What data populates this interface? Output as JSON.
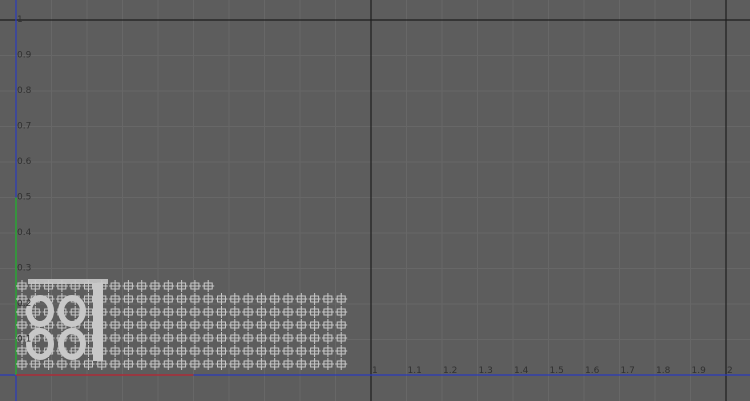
{
  "viewport": {
    "background_color": "#5d5d5d",
    "grid_minor_color": "#676767",
    "grid_major_color": "#1e1e1e",
    "axis_u_color": "#2b3bbd",
    "axis_v_color": "#2b3bbd",
    "axis_origin_x_color": "#b03030",
    "axis_origin_y_color": "#2da82d",
    "uv_shell_color": "#c8c8c8",
    "y_axis_labels": [
      "1",
      "0.9",
      "0.8",
      "0.7",
      "0.6",
      "0.5",
      "0.4",
      "0.3",
      "0.2",
      "0.1"
    ],
    "x_axis_labels": [
      "1",
      "1.1",
      "1.2",
      "1.3",
      "1.4",
      "1.5",
      "1.6",
      "1.7",
      "1.8",
      "1.9",
      "2"
    ],
    "uv_shell_columns": 25,
    "uv_shell_rows": 6
  }
}
